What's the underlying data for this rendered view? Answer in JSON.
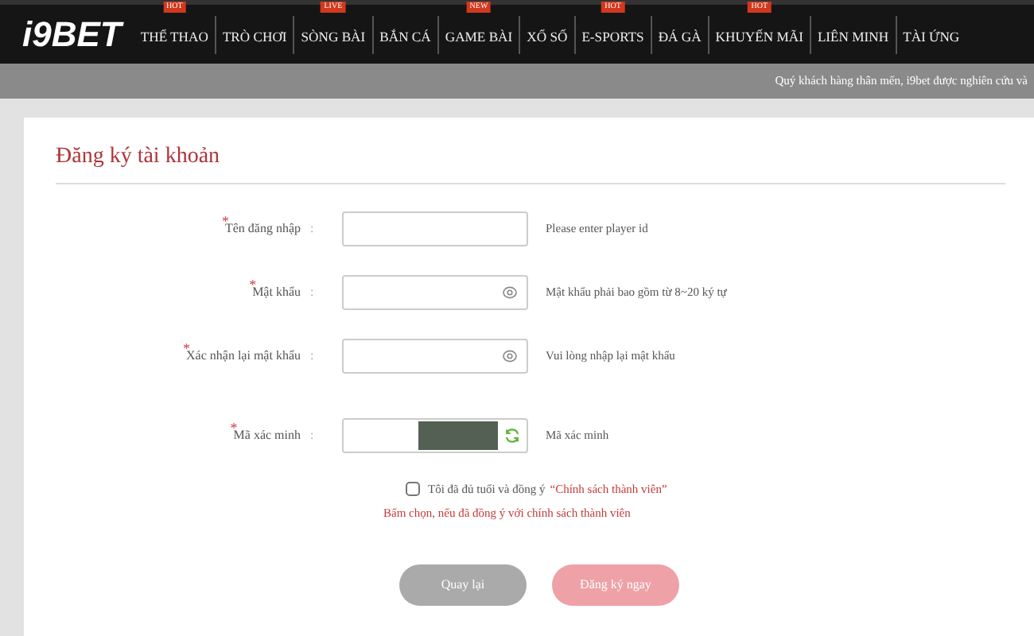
{
  "header": {
    "logo": "i9BET",
    "nav": [
      {
        "label": "THỂ THAO",
        "badge": "HOT"
      },
      {
        "label": "TRÒ CHƠI"
      },
      {
        "label": "SÒNG BÀI",
        "badge": "LIVE"
      },
      {
        "label": "BẮN CÁ"
      },
      {
        "label": "GAME BÀI",
        "badge": "NEW"
      },
      {
        "label": "XỔ SỐ"
      },
      {
        "label": "E-SPORTS",
        "badge": "HOT"
      },
      {
        "label": "ĐÁ GÀ"
      },
      {
        "label": "KHUYẾN MÃI",
        "badge": "HOT"
      },
      {
        "label": "LIÊN MINH"
      },
      {
        "label": "TÀI ỨNG"
      }
    ]
  },
  "notice": "Quý khách hàng thân mến, i9bet được nghiên cứu và",
  "form": {
    "title": "Đăng ký tài khoản",
    "fields": [
      {
        "kind": "text",
        "required_mark": "*",
        "label": "Tên đăng nhập",
        "separator": ":",
        "hint": "Please enter player id"
      },
      {
        "kind": "password",
        "required_mark": "*",
        "label": "Mật khẩu",
        "separator": ":",
        "hint": "Mật khẩu phải bao gồm từ 8~20 ký tự"
      },
      {
        "kind": "password",
        "required_mark": "*",
        "label": "Xác nhận lại mật khẩu",
        "separator": ":",
        "hint": "Vui lòng nhập lại mật khẩu"
      },
      {
        "kind": "captcha",
        "required_mark": "*",
        "label": "Mã xác minh",
        "separator": ":",
        "hint": "Mã xác minh"
      }
    ],
    "agree": {
      "checked": false,
      "text": "Tôi đã đủ tuổi và đồng ý",
      "link": "“Chính sách thành viên”",
      "warning": "Bấm chọn, nếu đã đồng ý với chính sách thành viên"
    },
    "buttons": [
      {
        "kind": "back",
        "label": "Quay lại"
      },
      {
        "kind": "submit",
        "label": "Đăng ký ngay"
      }
    ]
  }
}
